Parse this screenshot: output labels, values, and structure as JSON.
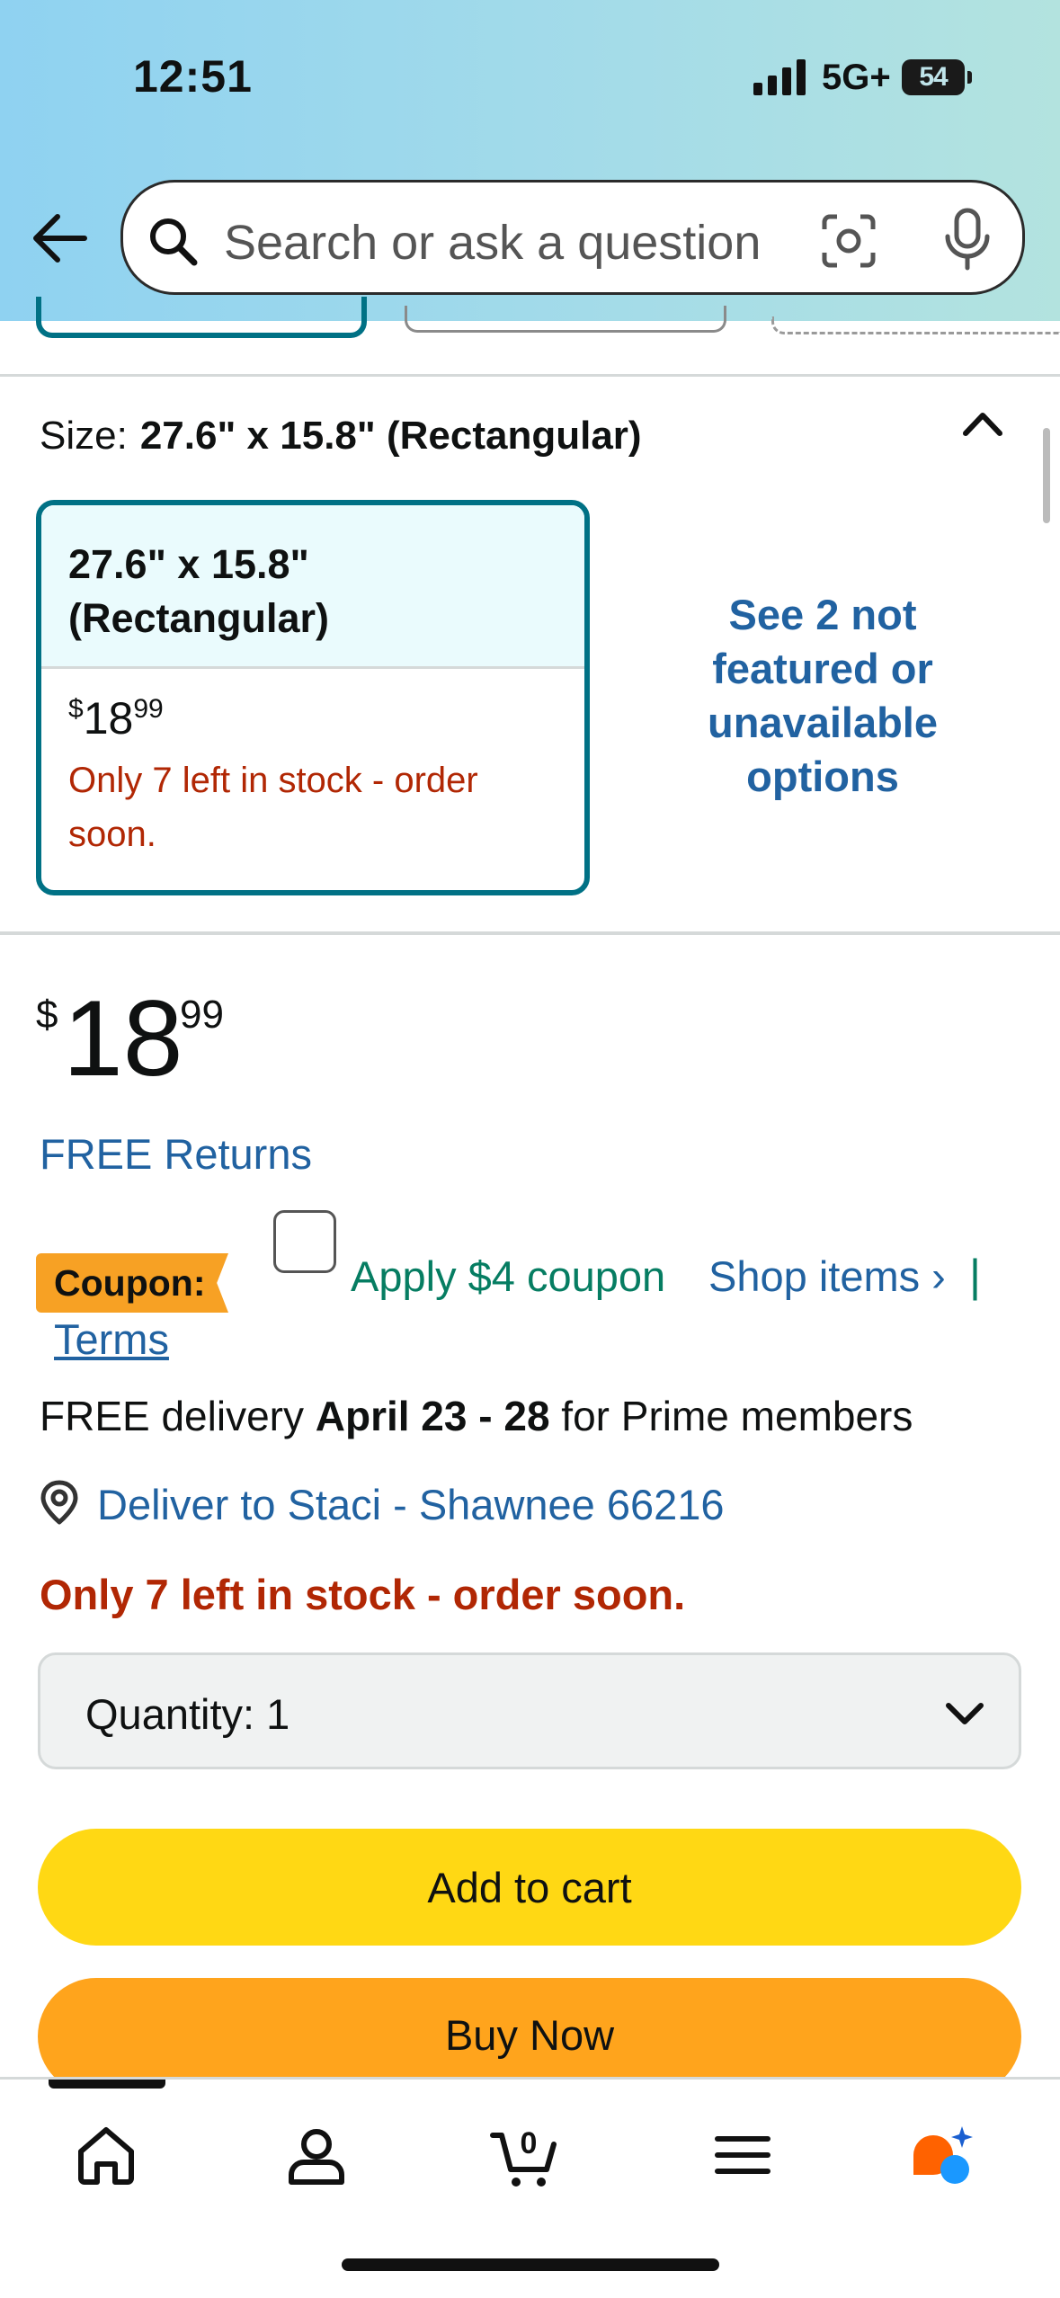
{
  "status_bar": {
    "time": "12:51",
    "network": "5G+",
    "battery": "54"
  },
  "search": {
    "placeholder": "Search or ask a question"
  },
  "size": {
    "label": "Size:",
    "selected": "27.6\" x 15.8\" (Rectangular)",
    "card": {
      "title_line1": "27.6\" x 15.8\"",
      "title_line2": "(Rectangular)",
      "price_symbol": "$",
      "price_whole": "18",
      "price_cents": "99",
      "stock": "Only 7 left in stock - order soon."
    },
    "see_more": "See 2 not featured or unavailable options"
  },
  "price": {
    "symbol": "$",
    "whole": "18",
    "cents": "99"
  },
  "free_returns": "FREE Returns",
  "coupon": {
    "badge": "Coupon:",
    "apply": "Apply $4 coupon",
    "shop_items": "Shop items ›",
    "separator": "|",
    "terms": "Terms",
    "checked": false
  },
  "delivery": {
    "prefix": "FREE delivery ",
    "dates": "April 23 - 28",
    "suffix": " for Prime members"
  },
  "deliver_to": "Deliver to Staci - Shawnee 66216",
  "stock_status": "Only 7 left in stock - order soon.",
  "quantity": {
    "label": "Quantity:",
    "value": "1"
  },
  "buttons": {
    "add_to_cart": "Add to cart",
    "buy_now": "Buy Now"
  },
  "tabbar": {
    "cart_count": "0",
    "active_tab": "home"
  },
  "colors": {
    "link": "#2162a1",
    "accent_teal": "#007185",
    "stock_red": "#b12704",
    "coupon_green": "#067d62",
    "add_to_cart": "#ffd814",
    "buy_now": "#ffa41c",
    "coupon_badge": "#f7a124"
  }
}
